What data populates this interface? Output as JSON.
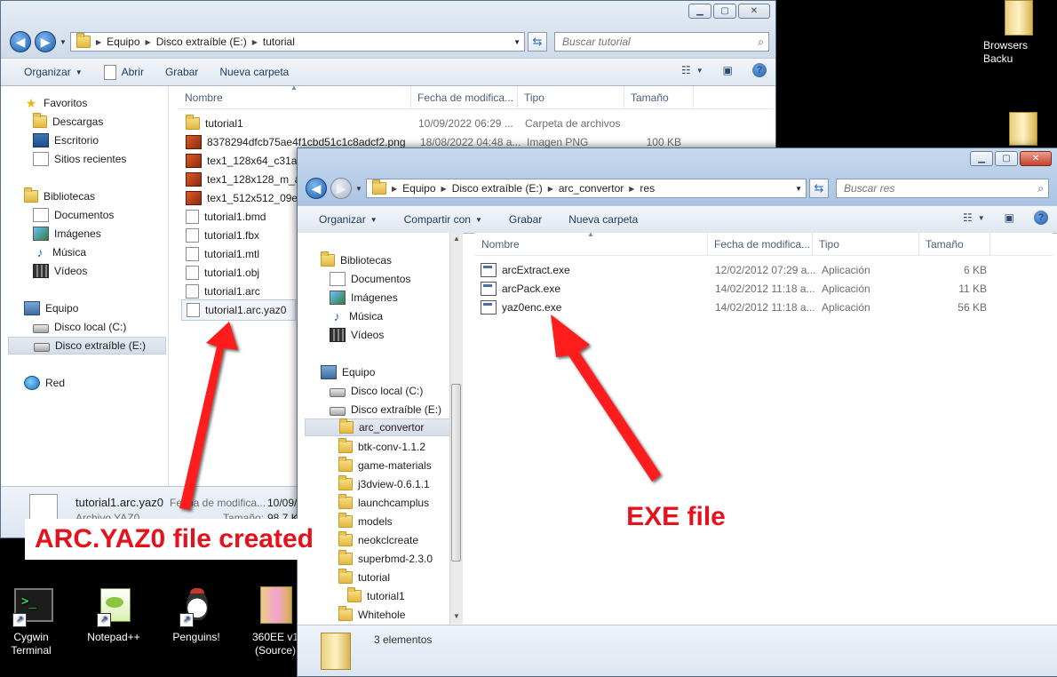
{
  "desktop": {
    "top_right_icon_label": "Browsers Backu",
    "bottom_icons": [
      {
        "label": "Cygwin\nTerminal",
        "line1": "Cygwin",
        "line2": "Terminal"
      },
      {
        "label": "Notepad++",
        "line1": "Notepad++",
        "line2": ""
      },
      {
        "label": "Penguins!",
        "line1": "Penguins!",
        "line2": ""
      },
      {
        "label": "360EE v1 (Source)",
        "line1": "360EE v1",
        "line2": "(Source)"
      }
    ]
  },
  "window_back": {
    "path": [
      "Equipo",
      "Disco extraíble (E:)",
      "tutorial"
    ],
    "search_placeholder": "Buscar tutorial",
    "toolbar": {
      "organize": "Organizar",
      "open": "Abrir",
      "burn": "Grabar",
      "new_folder": "Nueva carpeta"
    },
    "nav": {
      "favorites": "Favoritos",
      "downloads": "Descargas",
      "desktop": "Escritorio",
      "recent": "Sitios recientes",
      "libraries": "Bibliotecas",
      "documents": "Documentos",
      "images": "Imágenes",
      "music": "Música",
      "videos": "Vídeos",
      "computer": "Equipo",
      "local_disk": "Disco local (C:)",
      "removable": "Disco extraíble (E:)",
      "network": "Red"
    },
    "columns": {
      "name": "Nombre",
      "date": "Fecha de modifica...",
      "type": "Tipo",
      "size": "Tamaño"
    },
    "files": [
      {
        "name": "tutorial1",
        "date": "10/09/2022 06:29 ...",
        "type": "Carpeta de archivos",
        "size": ""
      },
      {
        "name": "8378294dfcb75ae4f1cbd51c1c8adcf2.png",
        "date": "18/08/2022 04:48 a...",
        "type": "Imagen PNG",
        "size": "100 KB"
      },
      {
        "name": "tex1_128x64_c31a988",
        "date": "",
        "type": "",
        "size": ""
      },
      {
        "name": "tex1_128x128_m_acb",
        "date": "",
        "type": "",
        "size": ""
      },
      {
        "name": "tex1_512x512_09e3c",
        "date": "",
        "type": "",
        "size": ""
      },
      {
        "name": "tutorial1.bmd",
        "date": "",
        "type": "",
        "size": ""
      },
      {
        "name": "tutorial1.fbx",
        "date": "",
        "type": "",
        "size": ""
      },
      {
        "name": "tutorial1.mtl",
        "date": "",
        "type": "",
        "size": ""
      },
      {
        "name": "tutorial1.obj",
        "date": "",
        "type": "",
        "size": ""
      },
      {
        "name": "tutorial1.arc",
        "date": "",
        "type": "",
        "size": ""
      },
      {
        "name": "tutorial1.arc.yaz0",
        "date": "",
        "type": "",
        "size": ""
      }
    ],
    "details": {
      "name": "tutorial1.arc.yaz0",
      "type_label": "Archivo YAZ0",
      "date_label": "Fecha de modifica...",
      "date_value": "10/09/",
      "size_label": "Tamaño:",
      "size_value": "98.7 K"
    }
  },
  "window_front": {
    "path": [
      "Equipo",
      "Disco extraíble (E:)",
      "arc_convertor",
      "res"
    ],
    "search_placeholder": "Buscar res",
    "toolbar": {
      "organize": "Organizar",
      "share": "Compartir con",
      "burn": "Grabar",
      "new_folder": "Nueva carpeta"
    },
    "nav": {
      "libraries": "Bibliotecas",
      "documents": "Documentos",
      "images": "Imágenes",
      "music": "Música",
      "videos": "Vídeos",
      "computer": "Equipo",
      "local_disk": "Disco local (C:)",
      "removable": "Disco extraíble (E:)",
      "folders": [
        "arc_convertor",
        "btk-conv-1.1.2",
        "game-materials",
        "j3dview-0.6.1.1",
        "launchcamplus",
        "models",
        "neokclcreate",
        "superbmd-2.3.0",
        "tutorial",
        "tutorial1",
        "Whitehole"
      ]
    },
    "columns": {
      "name": "Nombre",
      "date": "Fecha de modifica...",
      "type": "Tipo",
      "size": "Tamaño"
    },
    "files": [
      {
        "name": "arcExtract.exe",
        "date": "12/02/2012 07:29 a...",
        "type": "Aplicación",
        "size": "6 KB"
      },
      {
        "name": "arcPack.exe",
        "date": "14/02/2012 11:18 a...",
        "type": "Aplicación",
        "size": "11 KB"
      },
      {
        "name": "yaz0enc.exe",
        "date": "14/02/2012 11:18 a...",
        "type": "Aplicación",
        "size": "56 KB"
      }
    ],
    "status": "3 elementos"
  },
  "annotations": {
    "left": "ARC.YAZ0 file created",
    "right": "EXE file",
    "color": "#ff1a1a"
  }
}
